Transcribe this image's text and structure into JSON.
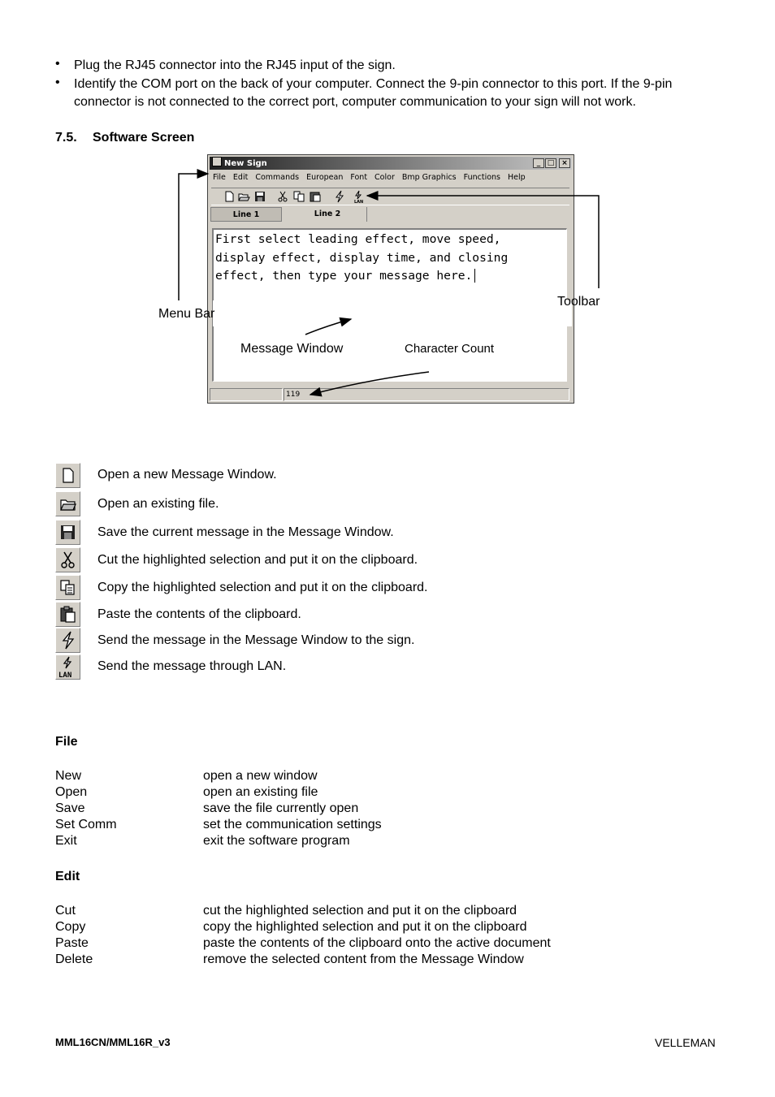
{
  "bullets": [
    "Plug the RJ45 connector into the RJ45 input of the sign.",
    "Identify the COM port on the back of your computer. Connect the 9-pin connector to this port. If the 9-pin connector is not connected to the correct port, computer communication to your sign will not work."
  ],
  "section": {
    "number": "7.5.",
    "title": "Software Screen"
  },
  "window": {
    "title": "New Sign",
    "menu": [
      "File",
      "Edit",
      "Commands",
      "European",
      "Font",
      "Color",
      "Bmp Graphics",
      "Functions",
      "Help"
    ],
    "tabs": [
      "Line 1",
      "Line 2"
    ],
    "message_lines": [
      "First select leading effect, move speed,",
      "display effect, display time, and closing",
      "effect, then type your message here."
    ],
    "char_count": "119"
  },
  "callouts": {
    "menu_bar": "Menu Bar",
    "toolbar": "Toolbar",
    "message_window": "Message Window",
    "character_count": "Character Count"
  },
  "toolbar_items": [
    {
      "icon": "new-document-icon",
      "text": "Open a new Message Window."
    },
    {
      "icon": "open-folder-icon",
      "text": "Open an existing file."
    },
    {
      "icon": "floppy-save-icon",
      "text": "Save the current message in the Message Window."
    },
    {
      "icon": "scissors-cut-icon",
      "text": "Cut the highlighted selection and put it on the clipboard."
    },
    {
      "icon": "copy-icon",
      "text": "Copy the highlighted selection and put it on the clipboard."
    },
    {
      "icon": "clipboard-paste-icon",
      "text": "Paste the contents of the clipboard."
    },
    {
      "icon": "send-lightning-icon",
      "text": "Send the message in the Message Window to the sign."
    },
    {
      "icon": "send-lan-icon",
      "text": "Send the message through LAN.",
      "badge": "LAN"
    }
  ],
  "file_menu": {
    "heading": "File",
    "items": [
      {
        "term": "New",
        "def": "open a new window"
      },
      {
        "term": "Open",
        "def": "open an existing file"
      },
      {
        "term": "Save",
        "def": "save the file currently open"
      },
      {
        "term": "Set Comm",
        "def": "set the communication settings"
      },
      {
        "term": "Exit",
        "def": "exit the software program"
      }
    ]
  },
  "edit_menu": {
    "heading": "Edit",
    "items": [
      {
        "term": "Cut",
        "def": "cut the highlighted selection and put it on the clipboard"
      },
      {
        "term": "Copy",
        "def": "copy the highlighted selection and put it on the clipboard"
      },
      {
        "term": "Paste",
        "def": "paste the contents of the clipboard onto the active document"
      },
      {
        "term": "Delete",
        "def": "remove the selected content from the Message Window"
      }
    ]
  },
  "footer": {
    "left": "MML16CN/MML16R_v3",
    "right": "VELLEMAN"
  }
}
